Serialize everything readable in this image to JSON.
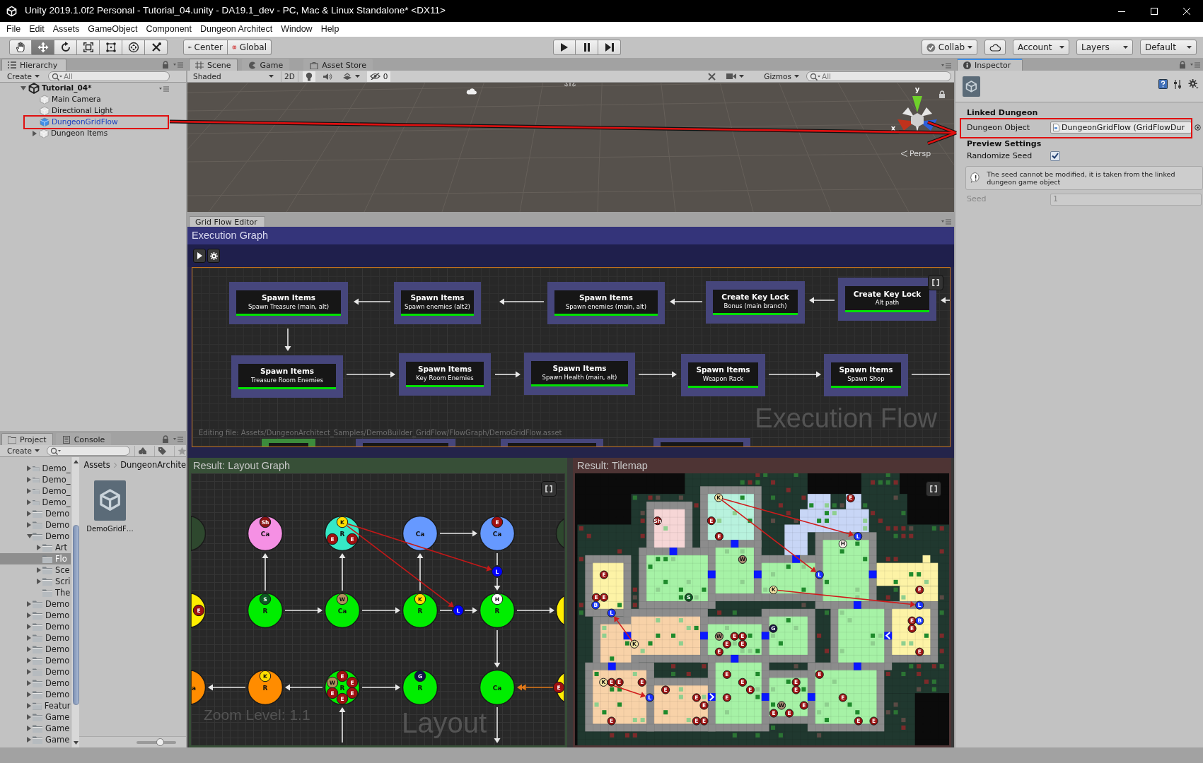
{
  "window": {
    "title": "Unity 2019.1.0f2 Personal - Tutorial_04.unity - DA19.1_dev - PC, Mac & Linux Standalone* <DX11>"
  },
  "menu": [
    "File",
    "Edit",
    "Assets",
    "GameObject",
    "Component",
    "Dungeon Architect",
    "Window",
    "Help"
  ],
  "toolbar": {
    "tools": [
      {
        "selected": false
      },
      {
        "selected": true
      },
      {
        "selected": false
      },
      {
        "selected": false
      },
      {
        "selected": false
      },
      {
        "selected": false
      },
      {
        "selected": false
      }
    ],
    "pivot": [
      {
        "label": "Center"
      },
      {
        "label": "Global"
      }
    ],
    "playback": [
      {
        "selected": false
      },
      {
        "selected": false
      },
      {
        "selected": false
      }
    ],
    "collab": "Collab",
    "account": "Account",
    "layers": "Layers",
    "layout": "Default"
  },
  "hierarchy": {
    "tab": "Hierarchy",
    "create": "Create",
    "search_placeholder": "All",
    "scene": {
      "label": "Tutorial_04*",
      "expanded": true,
      "children": [
        {
          "label": "Main Camera",
          "prefab": false
        },
        {
          "label": "Directional Light",
          "prefab": false
        },
        {
          "label": "DungeonGridFlow",
          "prefab": true
        },
        {
          "label": "Dungeon Items",
          "prefab": false,
          "expanded": false
        }
      ]
    }
  },
  "scene_view": {
    "tabs": [
      {
        "label": "Scene",
        "selected": true
      },
      {
        "label": "Game",
        "selected": false
      },
      {
        "label": "Asset Store",
        "selected": false
      }
    ],
    "shading": "Shaded",
    "mode_2d": "2D",
    "hidden_count": "0",
    "gizmos": "Gizmos",
    "search_placeholder": "All",
    "axes": [
      "y",
      "x"
    ],
    "projection": "Persp"
  },
  "grid_flow_editor": {
    "tab": "Grid Flow Editor",
    "execution_graph": {
      "title": "Execution Graph",
      "nodes": [
        {
          "title": "Spawn Items",
          "subtitle": "Spawn Treasure (main, alt)",
          "color": "#46467c"
        },
        {
          "title": "Spawn Items",
          "subtitle": "Spawn enemies (alt2)",
          "color": "#46467c"
        },
        {
          "title": "Spawn Items",
          "subtitle": "Spawn enemies (main, alt)",
          "color": "#46467c"
        },
        {
          "title": "Create Key Lock",
          "subtitle": "Bonus (main branch)",
          "color": "#46467c"
        },
        {
          "title": "Create Key Lock",
          "subtitle": "Alt path",
          "color": "#46467c"
        },
        {
          "title": "Spawn Items",
          "subtitle": "Treasure Room Enemies",
          "color": "#46467c"
        },
        {
          "title": "Spawn Items",
          "subtitle": "Key Room Enemies",
          "color": "#46467c"
        },
        {
          "title": "Spawn Items",
          "subtitle": "Spawn Health (main, alt)",
          "color": "#46467c"
        },
        {
          "title": "Spawn Items",
          "subtitle": "Weapon Rack",
          "color": "#46467c"
        },
        {
          "title": "Spawn Items",
          "subtitle": "Spawn Shop",
          "color": "#46467c"
        },
        {
          "color": "#3c8c3c"
        },
        {
          "color": "#46467c"
        },
        {
          "color": "#46467c"
        },
        {
          "color": "#46467c"
        }
      ],
      "file_note": "Editing file: Assets/DungeonArchitect_Samples/DemoBuilder_GridFlow/FlowGraph/DemoGridFlow.asset",
      "caption": "Execution Flow"
    },
    "layout_graph": {
      "title": "Result: Layout Graph",
      "zoom_note": "Zoom Level: 1.1",
      "caption": "Layout",
      "nodes": [
        {
          "color": "#2e482e"
        },
        {
          "label": "Ca",
          "color": "#f590e4",
          "items": [
            {
              "label": "Sh",
              "color": "#8c1414"
            }
          ]
        },
        {
          "label": "R",
          "color": "#36e8c6",
          "items": [
            {
              "label": "K",
              "color": "#ffdd00"
            },
            {
              "label": "E",
              "color": "#a01010"
            },
            {
              "label": "E",
              "color": "#a01010"
            }
          ]
        },
        {
          "label": "Ca",
          "color": "#6699ff"
        },
        {
          "label": "Ca",
          "color": "#6699ff",
          "items": [
            {
              "label": "E",
              "color": "#a01010"
            }
          ]
        },
        {
          "color": "#2e482e"
        },
        {
          "color": "#ffee00",
          "items": [
            {
              "label": "E",
              "color": "#a01010"
            }
          ]
        },
        {
          "label": "R",
          "color": "#00ee00",
          "items": [
            {
              "label": "S",
              "color": "#0c5a22"
            }
          ]
        },
        {
          "label": "Ca",
          "color": "#00ee00",
          "items": [
            {
              "label": "W",
              "color": "#b08f5c"
            }
          ]
        },
        {
          "label": "R",
          "color": "#00ee00",
          "items": [
            {
              "label": "K",
              "color": "#ffdd00"
            }
          ]
        },
        {
          "label": "R",
          "color": "#00ee00",
          "items": [
            {
              "label": "H",
              "color": "#ffffff"
            }
          ]
        },
        {
          "color": "#ffee00"
        },
        {
          "label": "a",
          "color": "#ff8c00"
        },
        {
          "label": "R",
          "color": "#ff8c00",
          "items": [
            {
              "label": "K",
              "color": "#ffdd00"
            }
          ]
        },
        {
          "label": "R",
          "color": "#00ee00",
          "items": [
            {
              "label": "E",
              "color": "#a01010"
            },
            {
              "label": "W",
              "color": "#b08f5c"
            },
            {
              "label": "E",
              "color": "#a01010"
            },
            {
              "label": "E",
              "color": "#a01010"
            },
            {
              "label": "E",
              "color": "#a01010"
            },
            {
              "label": "E",
              "color": "#a01010"
            }
          ]
        },
        {
          "label": "R",
          "color": "#00ee00",
          "items": [
            {
              "label": "G",
              "color": "#10104a"
            }
          ]
        },
        {
          "label": "Ca",
          "color": "#00ee00"
        },
        {
          "color": "#ffee00",
          "items": [
            {
              "label": "E",
              "color": "#a01010"
            }
          ]
        }
      ],
      "locks": [
        {
          "label": "L",
          "color": "#0000ff"
        },
        {
          "label": "L",
          "color": "#0000ff"
        }
      ]
    },
    "tilemap": {
      "title": "Result: Tilemap",
      "markers": [
        {
          "label": "K",
          "color": "#f2e2a2"
        },
        {
          "label": "E",
          "color": "#9c1212"
        },
        {
          "label": "Sh",
          "color": "#8c1414"
        },
        {
          "label": "E",
          "color": "#9c1212"
        },
        {
          "label": "E",
          "color": "#9c1212"
        },
        {
          "label": "L",
          "color": "#1830ff"
        },
        {
          "label": "H",
          "color": "#fff2ee"
        },
        {
          "label": "W",
          "color": "#a88a72"
        },
        {
          "label": "E",
          "color": "#9c1212"
        },
        {
          "label": "L",
          "color": "#1830ff"
        },
        {
          "label": "K",
          "color": "#f2e2a2"
        },
        {
          "label": "E",
          "color": "#9c1212"
        },
        {
          "label": "E",
          "color": "#9c1212"
        },
        {
          "label": "E",
          "color": "#9c1212"
        },
        {
          "label": "S",
          "color": "#0c5a22"
        },
        {
          "label": "B",
          "color": "#1838ff"
        },
        {
          "label": "L",
          "color": "#1830ff"
        },
        {
          "label": "L",
          "color": "#1830ff"
        },
        {
          "label": "E",
          "color": "#9c1212"
        },
        {
          "label": "B",
          "color": "#1838ff"
        },
        {
          "label": "G",
          "color": "#161640"
        },
        {
          "label": "E",
          "color": "#9c1212"
        },
        {
          "label": "W",
          "color": "#a88a72"
        },
        {
          "label": "E",
          "color": "#9c1212"
        },
        {
          "label": "E",
          "color": "#9c1212"
        },
        {
          "label": "K",
          "color": "#f2e2a2"
        },
        {
          "label": "E",
          "color": "#9c1212"
        },
        {
          "label": "E",
          "color": "#9c1212"
        },
        {
          "label": "E",
          "color": "#9c1212"
        },
        {
          "label": "E",
          "color": "#9c1212"
        },
        {
          "label": "E",
          "color": "#9c1212"
        },
        {
          "label": "E",
          "color": "#9c1212"
        },
        {
          "label": "K",
          "color": "#f2e2a2"
        },
        {
          "label": "E",
          "color": "#9c1212"
        },
        {
          "label": "E",
          "color": "#9c1212"
        },
        {
          "label": "E",
          "color": "#9c1212"
        },
        {
          "label": "E",
          "color": "#9c1212"
        },
        {
          "label": "E",
          "color": "#9c1212"
        },
        {
          "label": "E",
          "color": "#9c1212"
        },
        {
          "label": "E",
          "color": "#9c1212"
        },
        {
          "label": "E",
          "color": "#9c1212"
        },
        {
          "label": "L",
          "color": "#1830ff"
        },
        {
          "label": "E",
          "color": "#9c1212"
        },
        {
          "label": "E",
          "color": "#9c1212"
        },
        {
          "label": "E",
          "color": "#9c1212"
        },
        {
          "label": "E",
          "color": "#9c1212"
        },
        {
          "label": "W",
          "color": "#a88a72"
        },
        {
          "label": "E",
          "color": "#9c1212"
        },
        {
          "label": "E",
          "color": "#9c1212"
        },
        {
          "label": "E",
          "color": "#9c1212"
        },
        {
          "label": "E",
          "color": "#9c1212"
        },
        {
          "label": "E",
          "color": "#9c1212"
        },
        {
          "label": "E",
          "color": "#9c1212"
        },
        {
          "label": "E",
          "color": "#9c1212"
        },
        {
          "label": "E",
          "color": "#9c1212"
        }
      ]
    }
  },
  "inspector": {
    "tab": "Inspector",
    "linked_heading": "Linked Dungeon",
    "dungeon_object": {
      "label": "Dungeon Object",
      "value": "DungeonGridFlow (GridFlowDur"
    },
    "preview_heading": "Preview Settings",
    "randomize_seed": {
      "label": "Randomize Seed",
      "checked": true
    },
    "help": "The seed cannot be modified, it is taken from the linked dungeon game object",
    "seed": {
      "label": "Seed",
      "value": "1",
      "disabled": true
    }
  },
  "project": {
    "tabs": [
      {
        "label": "Project",
        "selected": true
      },
      {
        "label": "Console",
        "selected": false
      }
    ],
    "create": "Create",
    "folders": [
      {
        "label": "Demo_",
        "expanded": false,
        "selected": false
      },
      {
        "label": "Demo_",
        "expanded": false,
        "selected": false
      },
      {
        "label": "Demo_",
        "expanded": false,
        "selected": false
      },
      {
        "label": "Demo_",
        "expanded": false,
        "selected": false
      },
      {
        "label": "Demo",
        "expanded": false,
        "selected": false
      },
      {
        "label": "Demo",
        "expanded": false,
        "selected": false
      },
      {
        "label": "Demo",
        "expanded": true,
        "selected": false,
        "children": [
          {
            "label": "Art",
            "expanded": false,
            "selected": false
          },
          {
            "label": "Flo",
            "selected": true
          },
          {
            "label": "Sce",
            "expanded": false,
            "selected": false
          },
          {
            "label": "Scri",
            "expanded": false,
            "selected": false
          },
          {
            "label": "The",
            "selected": false
          }
        ]
      },
      {
        "label": "Demo",
        "expanded": false,
        "selected": false
      },
      {
        "label": "Demo",
        "expanded": false,
        "selected": false
      },
      {
        "label": "Demo",
        "expanded": false,
        "selected": false
      },
      {
        "label": "Demo",
        "expanded": false,
        "selected": false
      },
      {
        "label": "Demo",
        "expanded": false,
        "selected": false
      },
      {
        "label": "Demo",
        "expanded": false,
        "selected": false
      },
      {
        "label": "Demo",
        "expanded": false,
        "selected": false
      },
      {
        "label": "Demo",
        "expanded": false,
        "selected": false
      },
      {
        "label": "Demo",
        "expanded": false,
        "selected": false
      },
      {
        "label": "Featur",
        "expanded": false,
        "selected": false
      },
      {
        "label": "Game",
        "expanded": false,
        "selected": false
      },
      {
        "label": "Game",
        "expanded": false,
        "selected": false
      },
      {
        "label": "Game",
        "expanded": false,
        "selected": false
      }
    ],
    "breadcrumb": [
      "Assets",
      "DungeonArchite"
    ],
    "assets": [
      {
        "label": "DemoGridF…"
      }
    ],
    "thumbnail_size": {
      "level": 0.6
    }
  }
}
